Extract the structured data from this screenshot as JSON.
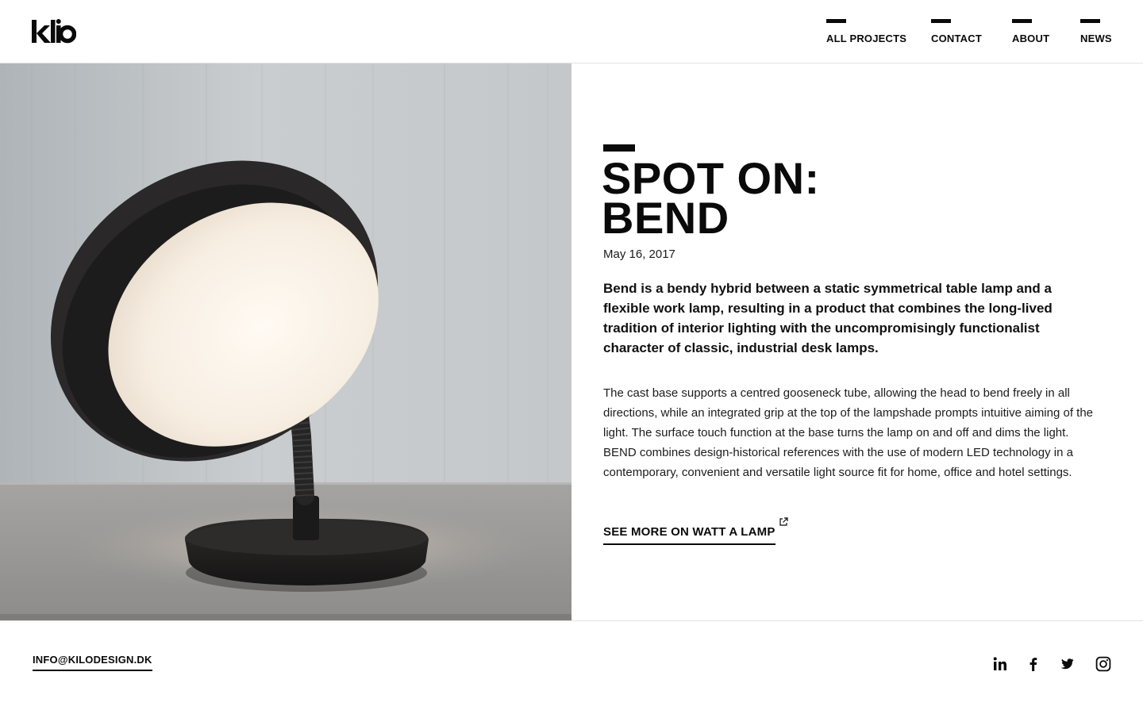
{
  "brand": {
    "logo_text": "kilo"
  },
  "nav": {
    "items": [
      {
        "label": "ALL PROJECTS"
      },
      {
        "label": "CONTACT"
      },
      {
        "label": "ABOUT"
      },
      {
        "label": "NEWS"
      }
    ]
  },
  "hero": {
    "image_subject": "Bend table lamp, dark shade with gooseneck stem and round base"
  },
  "article": {
    "title_line1": "SPOT ON:",
    "title_line2": "BEND",
    "date": "May 16, 2017",
    "lead": "Bend is a bendy hybrid between a static symmetrical table lamp and a flexible work lamp, resulting in a product that combines the long-lived tradition of interior lighting with the uncompromisingly functionalist character of classic, industrial desk lamps.",
    "body": "The cast base supports a centred gooseneck tube, allowing the head to bend freely in all directions, while an integrated grip at the top of the lampshade prompts intuitive aiming of the light. The surface touch function at the base turns the lamp on and off and dims the light. BEND combines design-historical references with the use of modern LED technology in a contemporary, convenient and versatile light source fit for home, office and hotel settings.",
    "link_label": "SEE MORE ON WATT A LAMP",
    "link_icon": "external-link-icon"
  },
  "footer": {
    "email": "INFO@KILODESIGN.DK",
    "social": [
      "linkedin-icon",
      "facebook-icon",
      "twitter-icon",
      "instagram-icon"
    ]
  },
  "colors": {
    "text": "#0a0a0a",
    "background": "#ffffff",
    "divider": "#e2e2e2"
  }
}
